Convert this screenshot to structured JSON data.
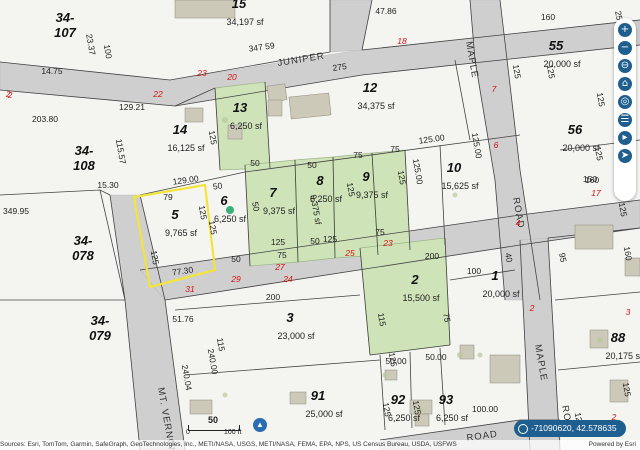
{
  "roads": {
    "juniper": "JUNIPER",
    "maple_left": "MAPLE",
    "road_right": "ROAD",
    "maple_bottom": "MAPLE",
    "road_bottom": "ROAD",
    "mt_vernon": "MT. VERNON",
    "road_bottom_right": "RO"
  },
  "parcels": [
    {
      "id": "55",
      "area": "20,000 sf"
    },
    {
      "id": "12",
      "area": "34,375 sf"
    },
    {
      "id": "13",
      "area": "6,250 sf"
    },
    {
      "id": "14",
      "area": "16,125 sf"
    },
    {
      "id": "56",
      "area": "20,000 sf"
    },
    {
      "id": "10",
      "area": "15,625 sf"
    },
    {
      "id": "5",
      "area": "9,765 sf"
    },
    {
      "id": "6",
      "area": "6,250 sf"
    },
    {
      "id": "7",
      "area": "9,375 sf"
    },
    {
      "id": "8",
      "area": "6,250 sf"
    },
    {
      "id": "9",
      "area": "9,375 sf"
    },
    {
      "id": "2",
      "area": "15,500 sf"
    },
    {
      "id": "1",
      "area": "20,000 sf"
    },
    {
      "id": "3",
      "area": "23,000 sf"
    },
    {
      "id": "88",
      "area": "20,175 sf"
    },
    {
      "id": "91",
      "area": "25,000 sf"
    },
    {
      "id": "92",
      "area": "6,250 sf"
    },
    {
      "id": "93",
      "area": "6,250 sf"
    },
    {
      "id": "15",
      "area": "34,197 sf"
    }
  ],
  "blocks": [
    "34-107",
    "34-108",
    "34-078",
    "34-079"
  ],
  "dims": [
    "100",
    "23.37",
    "14.75",
    "347 59",
    "275",
    "125",
    "125",
    "129.21",
    "203.80",
    "115.57",
    "15.30",
    "129.00",
    "50",
    "125",
    "50",
    "50",
    "75",
    "125.00",
    "125.00",
    "160",
    "125",
    "125",
    "50",
    "125",
    "9,375 sf",
    "125",
    "125",
    "125",
    "75",
    "125.00",
    "79",
    "125",
    "125",
    "77.30",
    "349.95",
    "50",
    "75",
    "50",
    "75",
    "200",
    "100",
    "40",
    "95",
    "125",
    "200",
    "115",
    "75",
    "51.76",
    "115",
    "240.00",
    "240.04",
    "50.00",
    "50.00",
    "125",
    "125",
    "100.00",
    "47.86",
    "160",
    "25",
    "125",
    "125",
    "150",
    "160",
    "125",
    "125",
    "125",
    "125"
  ],
  "red_labels": [
    "2",
    "23",
    "20",
    "18",
    "22",
    "7",
    "6",
    "17",
    "18",
    "4",
    "31",
    "29",
    "27",
    "24",
    "25",
    "23",
    "2",
    "3",
    "2"
  ],
  "toolbar": {
    "items": [
      "+",
      "−",
      "⊖",
      "⌂",
      "◎",
      "☰",
      "▸",
      "➤"
    ]
  },
  "coords": {
    "text": "-71090620, 42.578635"
  },
  "scale": {
    "zero": "0",
    "mid": "50",
    "end": "100 ft"
  },
  "attribution": {
    "text": "Sources: Esri, TomTom, Garmin, SafeGraph, GeoTechnologies, Inc., METI/NASA, USGS, METI/NASA, FEMA, EPA, NPS, US Census Bureau, USDA, USFWS",
    "powered": "Powered by Esri"
  },
  "corner_labels": {
    "top_left": "2"
  }
}
